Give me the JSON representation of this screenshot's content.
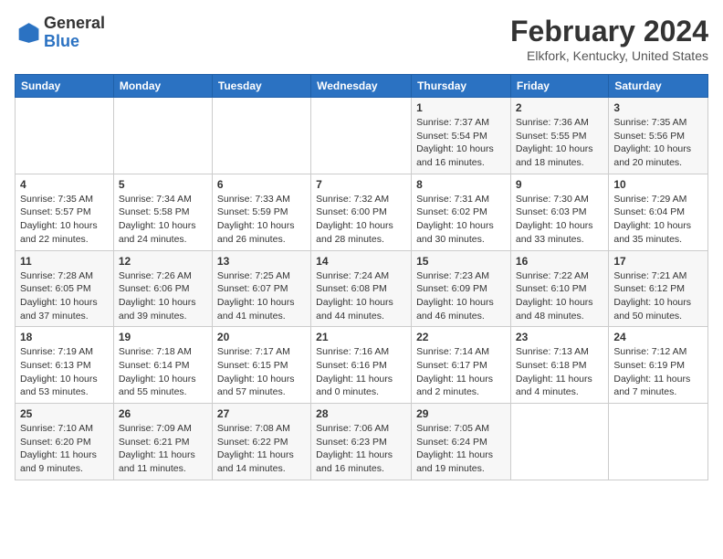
{
  "header": {
    "logo_line1": "General",
    "logo_line2": "Blue",
    "title": "February 2024",
    "subtitle": "Elkfork, Kentucky, United States"
  },
  "weekdays": [
    "Sunday",
    "Monday",
    "Tuesday",
    "Wednesday",
    "Thursday",
    "Friday",
    "Saturday"
  ],
  "weeks": [
    [
      {
        "day": "",
        "info": ""
      },
      {
        "day": "",
        "info": ""
      },
      {
        "day": "",
        "info": ""
      },
      {
        "day": "",
        "info": ""
      },
      {
        "day": "1",
        "info": "Sunrise: 7:37 AM\nSunset: 5:54 PM\nDaylight: 10 hours\nand 16 minutes."
      },
      {
        "day": "2",
        "info": "Sunrise: 7:36 AM\nSunset: 5:55 PM\nDaylight: 10 hours\nand 18 minutes."
      },
      {
        "day": "3",
        "info": "Sunrise: 7:35 AM\nSunset: 5:56 PM\nDaylight: 10 hours\nand 20 minutes."
      }
    ],
    [
      {
        "day": "4",
        "info": "Sunrise: 7:35 AM\nSunset: 5:57 PM\nDaylight: 10 hours\nand 22 minutes."
      },
      {
        "day": "5",
        "info": "Sunrise: 7:34 AM\nSunset: 5:58 PM\nDaylight: 10 hours\nand 24 minutes."
      },
      {
        "day": "6",
        "info": "Sunrise: 7:33 AM\nSunset: 5:59 PM\nDaylight: 10 hours\nand 26 minutes."
      },
      {
        "day": "7",
        "info": "Sunrise: 7:32 AM\nSunset: 6:00 PM\nDaylight: 10 hours\nand 28 minutes."
      },
      {
        "day": "8",
        "info": "Sunrise: 7:31 AM\nSunset: 6:02 PM\nDaylight: 10 hours\nand 30 minutes."
      },
      {
        "day": "9",
        "info": "Sunrise: 7:30 AM\nSunset: 6:03 PM\nDaylight: 10 hours\nand 33 minutes."
      },
      {
        "day": "10",
        "info": "Sunrise: 7:29 AM\nSunset: 6:04 PM\nDaylight: 10 hours\nand 35 minutes."
      }
    ],
    [
      {
        "day": "11",
        "info": "Sunrise: 7:28 AM\nSunset: 6:05 PM\nDaylight: 10 hours\nand 37 minutes."
      },
      {
        "day": "12",
        "info": "Sunrise: 7:26 AM\nSunset: 6:06 PM\nDaylight: 10 hours\nand 39 minutes."
      },
      {
        "day": "13",
        "info": "Sunrise: 7:25 AM\nSunset: 6:07 PM\nDaylight: 10 hours\nand 41 minutes."
      },
      {
        "day": "14",
        "info": "Sunrise: 7:24 AM\nSunset: 6:08 PM\nDaylight: 10 hours\nand 44 minutes."
      },
      {
        "day": "15",
        "info": "Sunrise: 7:23 AM\nSunset: 6:09 PM\nDaylight: 10 hours\nand 46 minutes."
      },
      {
        "day": "16",
        "info": "Sunrise: 7:22 AM\nSunset: 6:10 PM\nDaylight: 10 hours\nand 48 minutes."
      },
      {
        "day": "17",
        "info": "Sunrise: 7:21 AM\nSunset: 6:12 PM\nDaylight: 10 hours\nand 50 minutes."
      }
    ],
    [
      {
        "day": "18",
        "info": "Sunrise: 7:19 AM\nSunset: 6:13 PM\nDaylight: 10 hours\nand 53 minutes."
      },
      {
        "day": "19",
        "info": "Sunrise: 7:18 AM\nSunset: 6:14 PM\nDaylight: 10 hours\nand 55 minutes."
      },
      {
        "day": "20",
        "info": "Sunrise: 7:17 AM\nSunset: 6:15 PM\nDaylight: 10 hours\nand 57 minutes."
      },
      {
        "day": "21",
        "info": "Sunrise: 7:16 AM\nSunset: 6:16 PM\nDaylight: 11 hours\nand 0 minutes."
      },
      {
        "day": "22",
        "info": "Sunrise: 7:14 AM\nSunset: 6:17 PM\nDaylight: 11 hours\nand 2 minutes."
      },
      {
        "day": "23",
        "info": "Sunrise: 7:13 AM\nSunset: 6:18 PM\nDaylight: 11 hours\nand 4 minutes."
      },
      {
        "day": "24",
        "info": "Sunrise: 7:12 AM\nSunset: 6:19 PM\nDaylight: 11 hours\nand 7 minutes."
      }
    ],
    [
      {
        "day": "25",
        "info": "Sunrise: 7:10 AM\nSunset: 6:20 PM\nDaylight: 11 hours\nand 9 minutes."
      },
      {
        "day": "26",
        "info": "Sunrise: 7:09 AM\nSunset: 6:21 PM\nDaylight: 11 hours\nand 11 minutes."
      },
      {
        "day": "27",
        "info": "Sunrise: 7:08 AM\nSunset: 6:22 PM\nDaylight: 11 hours\nand 14 minutes."
      },
      {
        "day": "28",
        "info": "Sunrise: 7:06 AM\nSunset: 6:23 PM\nDaylight: 11 hours\nand 16 minutes."
      },
      {
        "day": "29",
        "info": "Sunrise: 7:05 AM\nSunset: 6:24 PM\nDaylight: 11 hours\nand 19 minutes."
      },
      {
        "day": "",
        "info": ""
      },
      {
        "day": "",
        "info": ""
      }
    ]
  ]
}
